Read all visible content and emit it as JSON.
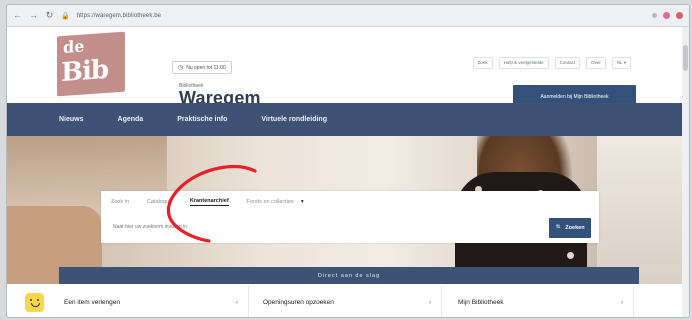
{
  "browser": {
    "url": "https://waregem.bibliotheek.be",
    "dot_colors": [
      "#e26b8f",
      "#d96060"
    ]
  },
  "header": {
    "logo_top": "de",
    "logo_bottom": "Bib",
    "open_status": "Nu open tot 11:00",
    "library_label": "Bibliotheek",
    "library_name": "Waregem",
    "links": [
      "Zoek",
      "Hulp & veelgestelde",
      "Contact",
      "Over"
    ],
    "lang": "NL",
    "login_button": "Aanmelden bij Mijn Bibliotheek"
  },
  "nav": {
    "items": [
      "Nieuws",
      "Agenda",
      "Praktische info",
      "Virtuele rondleiding"
    ]
  },
  "search": {
    "tabs": [
      "Zoek in",
      "Catalogus",
      "Krantenarchief",
      "Fonds en collecties"
    ],
    "active_tab": "Krantenarchief",
    "placeholder": "Naar hier uw zoekterm invullen in",
    "button": "Zoeken"
  },
  "direct_band": "Direct aan de slag",
  "quick_links": [
    {
      "label": "Een item verlengen",
      "icon": "smiley-icon"
    },
    {
      "label": "Openingsuren opzoeken"
    },
    {
      "label": "Mijn Bibliotheek"
    }
  ],
  "colors": {
    "nav": "#3d5275",
    "button": "#33517a",
    "logo": "#c28f8a",
    "annotation": "#e8202a"
  }
}
